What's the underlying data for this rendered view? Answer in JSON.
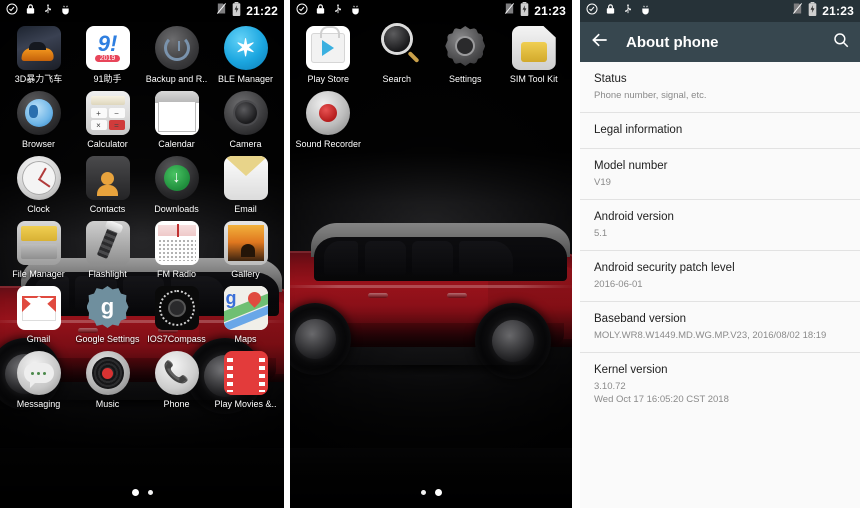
{
  "panels": {
    "launcher_page1": {
      "statusbar": {
        "time": "21:22",
        "icons_left": [
          "sync-icon",
          "lock-icon",
          "usb-icon",
          "adb-icon"
        ],
        "icons_right": [
          "no-sim-icon",
          "battery-charging-icon"
        ]
      },
      "apps": [
        {
          "label": "3D暴力飞车",
          "icon": "racing-game-icon"
        },
        {
          "label": "91助手",
          "icon": "assistant-91-icon",
          "badge": "2019",
          "glyph": "9!"
        },
        {
          "label": "Backup and R..",
          "icon": "backup-restore-icon"
        },
        {
          "label": "BLE Manager",
          "icon": "bluetooth-icon",
          "glyph": "✶"
        },
        {
          "label": "Browser",
          "icon": "browser-globe-icon"
        },
        {
          "label": "Calculator",
          "icon": "calculator-icon",
          "keys": [
            "+",
            "−",
            "×",
            "="
          ]
        },
        {
          "label": "Calendar",
          "icon": "calendar-icon"
        },
        {
          "label": "Camera",
          "icon": "camera-icon"
        },
        {
          "label": "Clock",
          "icon": "clock-icon"
        },
        {
          "label": "Contacts",
          "icon": "contacts-icon"
        },
        {
          "label": "Downloads",
          "icon": "downloads-icon",
          "glyph": "↓"
        },
        {
          "label": "Email",
          "icon": "email-envelope-icon"
        },
        {
          "label": "File Manager",
          "icon": "file-manager-icon"
        },
        {
          "label": "Flashlight",
          "icon": "flashlight-icon"
        },
        {
          "label": "FM Radio",
          "icon": "fm-radio-icon"
        },
        {
          "label": "Gallery",
          "icon": "gallery-icon"
        },
        {
          "label": "Gmail",
          "icon": "gmail-icon"
        },
        {
          "label": "Google Settings",
          "icon": "google-settings-icon",
          "glyph": "g"
        },
        {
          "label": "IOS7Compass",
          "icon": "compass-icon"
        },
        {
          "label": "Maps",
          "icon": "maps-icon",
          "glyph": "g"
        },
        {
          "label": "Messaging",
          "icon": "messaging-icon"
        },
        {
          "label": "Music",
          "icon": "music-icon"
        },
        {
          "label": "Phone",
          "icon": "phone-icon",
          "glyph": "📞"
        },
        {
          "label": "Play Movies &..",
          "icon": "play-movies-icon"
        }
      ],
      "pager": {
        "count": 2,
        "active": 1
      }
    },
    "launcher_page2": {
      "statusbar": {
        "time": "21:23",
        "icons_left": [
          "sync-icon",
          "lock-icon",
          "usb-icon",
          "adb-icon"
        ],
        "icons_right": [
          "no-sim-icon",
          "battery-charging-icon"
        ]
      },
      "apps": [
        {
          "label": "Play Store",
          "icon": "play-store-icon"
        },
        {
          "label": "Search",
          "icon": "search-magnifier-icon"
        },
        {
          "label": "Settings",
          "icon": "settings-gear-icon"
        },
        {
          "label": "SIM Tool Kit",
          "icon": "sim-card-icon"
        },
        {
          "label": "Sound Recorder",
          "icon": "sound-recorder-icon"
        }
      ],
      "pager": {
        "count": 2,
        "active": 2
      }
    },
    "about_phone": {
      "statusbar": {
        "time": "21:23",
        "icons_left": [
          "sync-icon",
          "lock-icon",
          "usb-icon",
          "adb-icon"
        ],
        "icons_right": [
          "no-sim-icon",
          "battery-charging-icon"
        ]
      },
      "appbar": {
        "back_icon": "back-arrow-icon",
        "title": "About phone",
        "search_icon": "search-icon"
      },
      "items": [
        {
          "title": "Status",
          "subtitle": "Phone number, signal, etc."
        },
        {
          "title": "Legal information",
          "subtitle": ""
        },
        {
          "title": "Model number",
          "subtitle": "V19"
        },
        {
          "title": "Android version",
          "subtitle": "5.1"
        },
        {
          "title": "Android security patch level",
          "subtitle": "2016-06-01"
        },
        {
          "title": "Baseband version",
          "subtitle": "MOLY.WR8.W1449.MD.WG.MP.V23, 2016/08/02 18:19"
        },
        {
          "title": "Kernel version",
          "subtitle": "3.10.72\nWed Oct 17 16:05:20 CST 2018"
        }
      ]
    }
  },
  "colors": {
    "appbar": "#37474f",
    "statusbar_dark": "#000000",
    "list_bg": "#fafafa",
    "primary_text": "#212121",
    "secondary_text": "#8a8a8a",
    "wallpaper_car": "#c81823"
  }
}
